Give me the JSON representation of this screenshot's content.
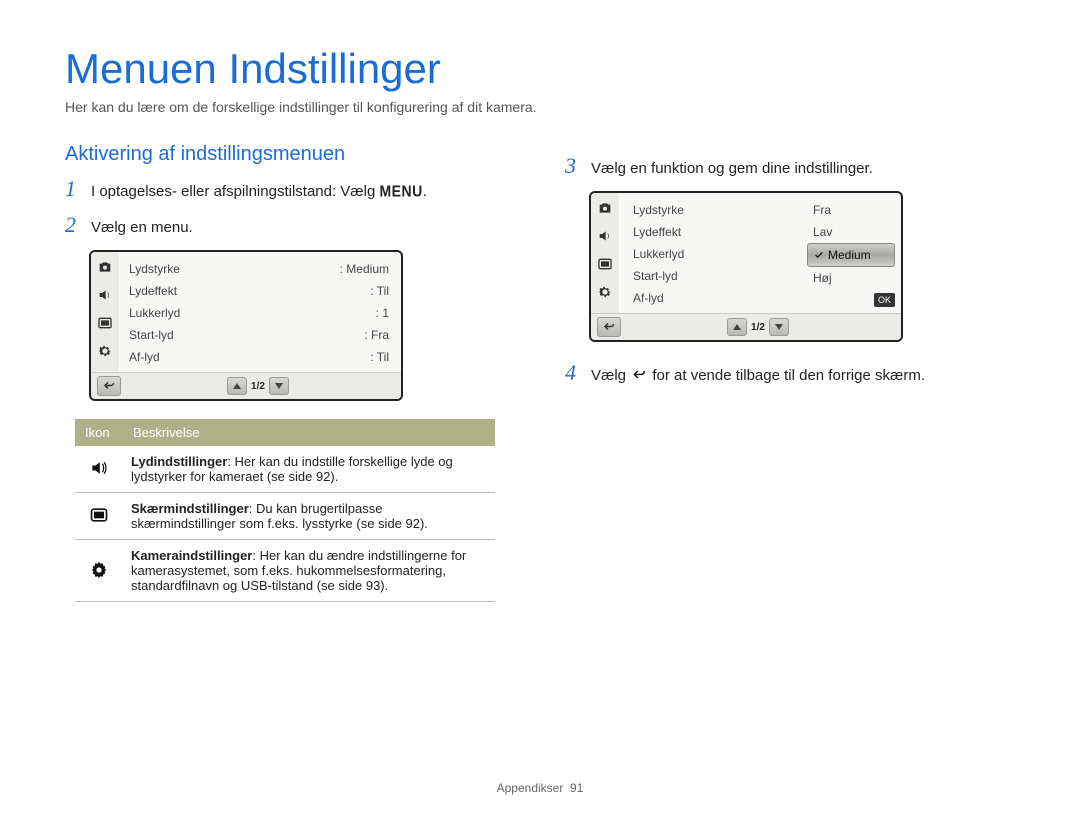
{
  "page_title": "Menuen Indstillinger",
  "intro": "Her kan du lære om de forskellige indstillinger til konfigurering af dit kamera.",
  "section_heading": "Aktivering af indstillingsmenuen",
  "steps": {
    "s1_pre": "I optagelses- eller afspilningstilstand: Vælg ",
    "s1_btn": "MENU",
    "s1_post": ".",
    "s2": "Vælg en menu.",
    "s3": "Vælg en funktion og gem dine indstillinger.",
    "s4_pre": "Vælg ",
    "s4_post": " for at vende tilbage til den forrige skærm."
  },
  "screen1": {
    "rows": [
      {
        "label": "Lydstyrke",
        "value": ": Medium"
      },
      {
        "label": "Lydeffekt",
        "value": ": Til"
      },
      {
        "label": "Lukkerlyd",
        "value": ": 1"
      },
      {
        "label": "Start-lyd",
        "value": ": Fra"
      },
      {
        "label": "Af-lyd",
        "value": ": Til"
      }
    ],
    "pager": "1/2"
  },
  "screen2": {
    "rows": [
      {
        "label": "Lydstyrke"
      },
      {
        "label": "Lydeffekt"
      },
      {
        "label": "Lukkerlyd"
      },
      {
        "label": "Start-lyd"
      },
      {
        "label": "Af-lyd"
      }
    ],
    "choices": [
      "Fra",
      "Lav",
      "Medium",
      "Høj"
    ],
    "ok": "OK",
    "pager": "1/2"
  },
  "table": {
    "h1": "Ikon",
    "h2": "Beskrivelse",
    "r1_b": "Lydindstillinger",
    "r1_t": ": Her kan du indstille forskellige lyde og lydstyrker for kameraet (se side 92).",
    "r2_b": "Skærmindstillinger",
    "r2_t": ": Du kan brugertilpasse skærmindstillinger som f.eks. lysstyrke (se side 92).",
    "r3_b": "Kameraindstillinger",
    "r3_t": ": Her kan du ændre indstillingerne for kamerasystemet, som f.eks. hukommelsesformatering, standardfilnavn og USB-tilstand (se side 93)."
  },
  "footer": {
    "label": "Appendikser",
    "page": "91"
  }
}
